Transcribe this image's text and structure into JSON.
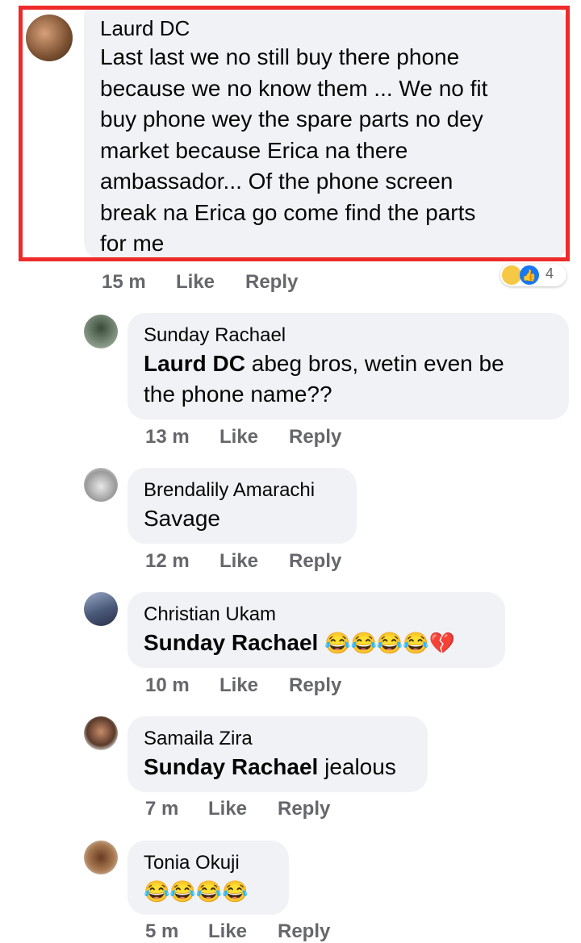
{
  "comments": [
    {
      "author": "Laurd DC",
      "lines": [
        "Last last we no still buy there phone",
        "because we no know them ... We no fit",
        "buy phone wey the spare parts no dey",
        "market because Erica na there",
        "ambassador... Of the phone screen",
        "break na Erica go come find the parts",
        "for me"
      ],
      "time": "15 m",
      "like": "Like",
      "reply": "Reply",
      "reaction_count": "4"
    },
    {
      "author": "Sunday Rachael",
      "tag": "Laurd DC",
      "line1_rest": " abeg bros, wetin even be",
      "line2": "the phone name??",
      "time": "13 m",
      "like": "Like",
      "reply": "Reply"
    },
    {
      "author": "Brendalily Amarachi",
      "text": "Savage",
      "time": "12 m",
      "like": "Like",
      "reply": "Reply"
    },
    {
      "author": "Christian Ukam",
      "tag": "Sunday Rachael",
      "emoji_text": "😂😂😂😂💔",
      "time": "10 m",
      "like": "Like",
      "reply": "Reply"
    },
    {
      "author": "Samaila Zira",
      "tag": "Sunday Rachael",
      "rest": " jealous",
      "time": "7 m",
      "like": "Like",
      "reply": "Reply"
    },
    {
      "author": "Tonia Okuji",
      "emoji_text": "😂😂😂😂",
      "time": "5 m",
      "like": "Like",
      "reply": "Reply"
    }
  ],
  "colors": {
    "bubble": "#f0f2f5",
    "meta": "#65676b",
    "highlight": "#ee2a2a",
    "like_blue": "#1877f2"
  }
}
